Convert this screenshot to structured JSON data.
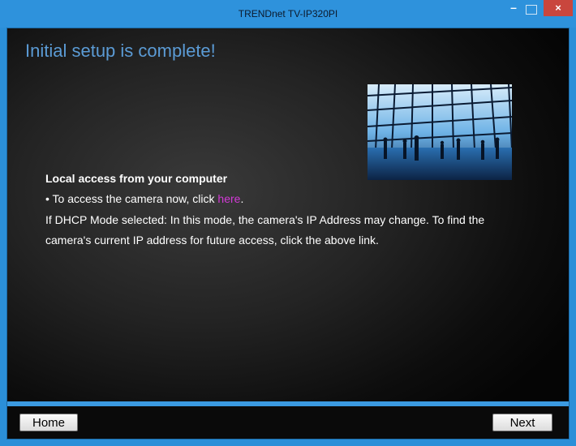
{
  "window": {
    "title": "TRENDnet TV-IP320PI",
    "controls": {
      "minimize": "–",
      "close": "×"
    }
  },
  "main": {
    "heading": "Initial setup is complete!",
    "section_title": "Local access from your computer",
    "access_prefix": "• To access the camera now, click ",
    "access_link": "here",
    "access_suffix": ".",
    "dhcp_line1": "If DHCP Mode selected: In this mode, the camera's IP Address may change. To find the",
    "dhcp_line2": "camera's current IP address for future access, click the above link."
  },
  "footer": {
    "home_label": "Home",
    "next_label": "Next"
  },
  "colors": {
    "accent": "#2e92dc",
    "heading": "#5b9bd5",
    "link": "#d23ad6",
    "close": "#c9463d"
  }
}
